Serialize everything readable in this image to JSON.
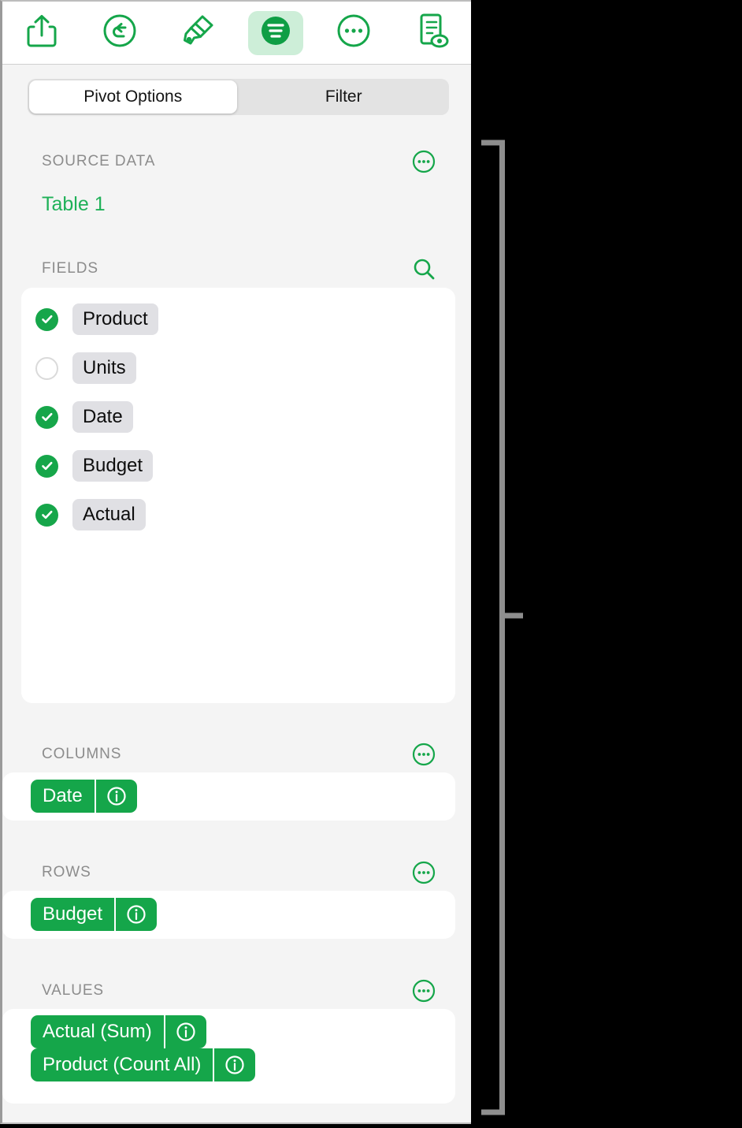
{
  "toolbar": {
    "buttons": [
      {
        "name": "share-icon",
        "label": "Share",
        "active": false
      },
      {
        "name": "undo-icon",
        "label": "Undo",
        "active": false
      },
      {
        "name": "paintbrush-icon",
        "label": "Format",
        "active": false
      },
      {
        "name": "pivot-icon",
        "label": "Organize",
        "active": true
      },
      {
        "name": "ellipsis-circle-icon",
        "label": "More",
        "active": false
      },
      {
        "name": "document-preview-icon",
        "label": "Document Options",
        "active": false
      }
    ]
  },
  "segmented": {
    "tabs": [
      {
        "label": "Pivot Options",
        "active": true
      },
      {
        "label": "Filter",
        "active": false
      }
    ]
  },
  "source_data": {
    "header": "SOURCE DATA",
    "table_name": "Table 1"
  },
  "fields": {
    "header": "FIELDS",
    "items": [
      {
        "label": "Product",
        "checked": true
      },
      {
        "label": "Units",
        "checked": false
      },
      {
        "label": "Date",
        "checked": true
      },
      {
        "label": "Budget",
        "checked": true
      },
      {
        "label": "Actual",
        "checked": true
      }
    ]
  },
  "columns": {
    "header": "COLUMNS",
    "tokens": [
      {
        "label": "Date"
      }
    ]
  },
  "rows": {
    "header": "ROWS",
    "tokens": [
      {
        "label": "Budget"
      }
    ]
  },
  "values": {
    "header": "VALUES",
    "tokens": [
      {
        "label": "Actual (Sum)"
      },
      {
        "label": "Product (Count All)"
      }
    ]
  },
  "colors": {
    "accent_green": "#15a64a",
    "accent_green_light": "#1fb158",
    "active_tab_bg": "#cdeed8",
    "panel_bg": "#f4f4f4",
    "card_bg": "#ffffff",
    "chip_bg": "#e0e0e4",
    "header_text": "#8c8c8c",
    "callout_gray": "#8e8e8e",
    "backdrop": "#000000"
  }
}
